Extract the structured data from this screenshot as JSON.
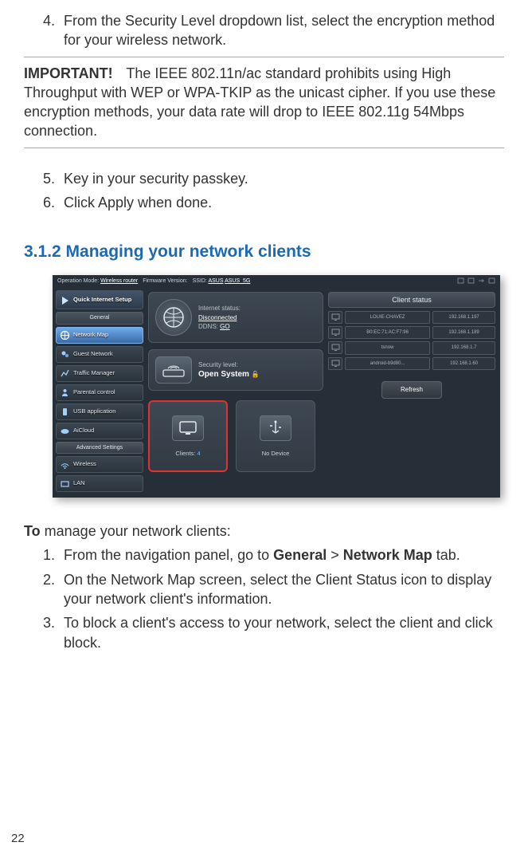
{
  "steps_top": {
    "s4": {
      "num": "4.",
      "text": "From the Security Level dropdown list, select the encryption method for your wireless network."
    }
  },
  "important": {
    "label": "IMPORTANT!",
    "text": "The IEEE 802.11n/ac standard prohibits using High Throughput with WEP or WPA-TKIP as the unicast cipher. If you use these encryption methods, your data rate will drop to IEEE 802.11g 54Mbps connection."
  },
  "steps_mid": {
    "s5": {
      "num": "5.",
      "text": "Key in your security passkey."
    },
    "s6": {
      "num": "6.",
      "text": "Click Apply when done."
    }
  },
  "section_heading": "3.1.2 Managing your network clients",
  "router": {
    "topbar": {
      "opmode_label": "Operation Mode:",
      "opmode_value": "Wireless router",
      "fw_label": "Firmware Version:",
      "ssid_label": "SSID:",
      "ssid1": "ASUS",
      "ssid2": "ASUS_5G"
    },
    "sidebar": {
      "quick": "Quick Internet Setup",
      "general_header": "General",
      "items": [
        "Network Map",
        "Guest Network",
        "Traffic Manager",
        "Parental control",
        "USB application",
        "AiCloud"
      ],
      "advanced_header": "Advanced Settings",
      "adv_items": [
        "Wireless",
        "LAN"
      ]
    },
    "cards": {
      "internet": {
        "l1": "Internet status:",
        "l2": "Disconnected",
        "l3_label": "DDNS:",
        "l3_value": "GO"
      },
      "security": {
        "l1": "Security level:",
        "l2": "Open System"
      },
      "clients": {
        "label": "Clients:",
        "count": "4"
      },
      "nodevice": "No Device"
    },
    "client_status": {
      "title": "Client status",
      "rows": [
        {
          "name": "LOUIE-CHAVEZ",
          "ip": "192.168.1.197"
        },
        {
          "name": "B0:EC:71:AC:F7:96",
          "ip": "192.168.1.189"
        },
        {
          "name": "tsnow",
          "ip": "192.168.1.7"
        },
        {
          "name": "android-b9d80...",
          "ip": "192.168.1.60"
        }
      ],
      "refresh": "Refresh"
    }
  },
  "intro": {
    "bold": "To",
    "rest": " manage your network clients:"
  },
  "steps_bottom": {
    "s1": {
      "num": "1.",
      "pre": "From the navigation panel, go to ",
      "b1": "General",
      "mid": " > ",
      "b2": "Network Map",
      "post": " tab."
    },
    "s2": {
      "num": "2.",
      "text": "On the Network Map screen, select the Client Status icon to display your network client's information."
    },
    "s3": {
      "num": "3.",
      "text": "To block a client's access to your network, select the client and click block."
    }
  },
  "page_number": "22"
}
